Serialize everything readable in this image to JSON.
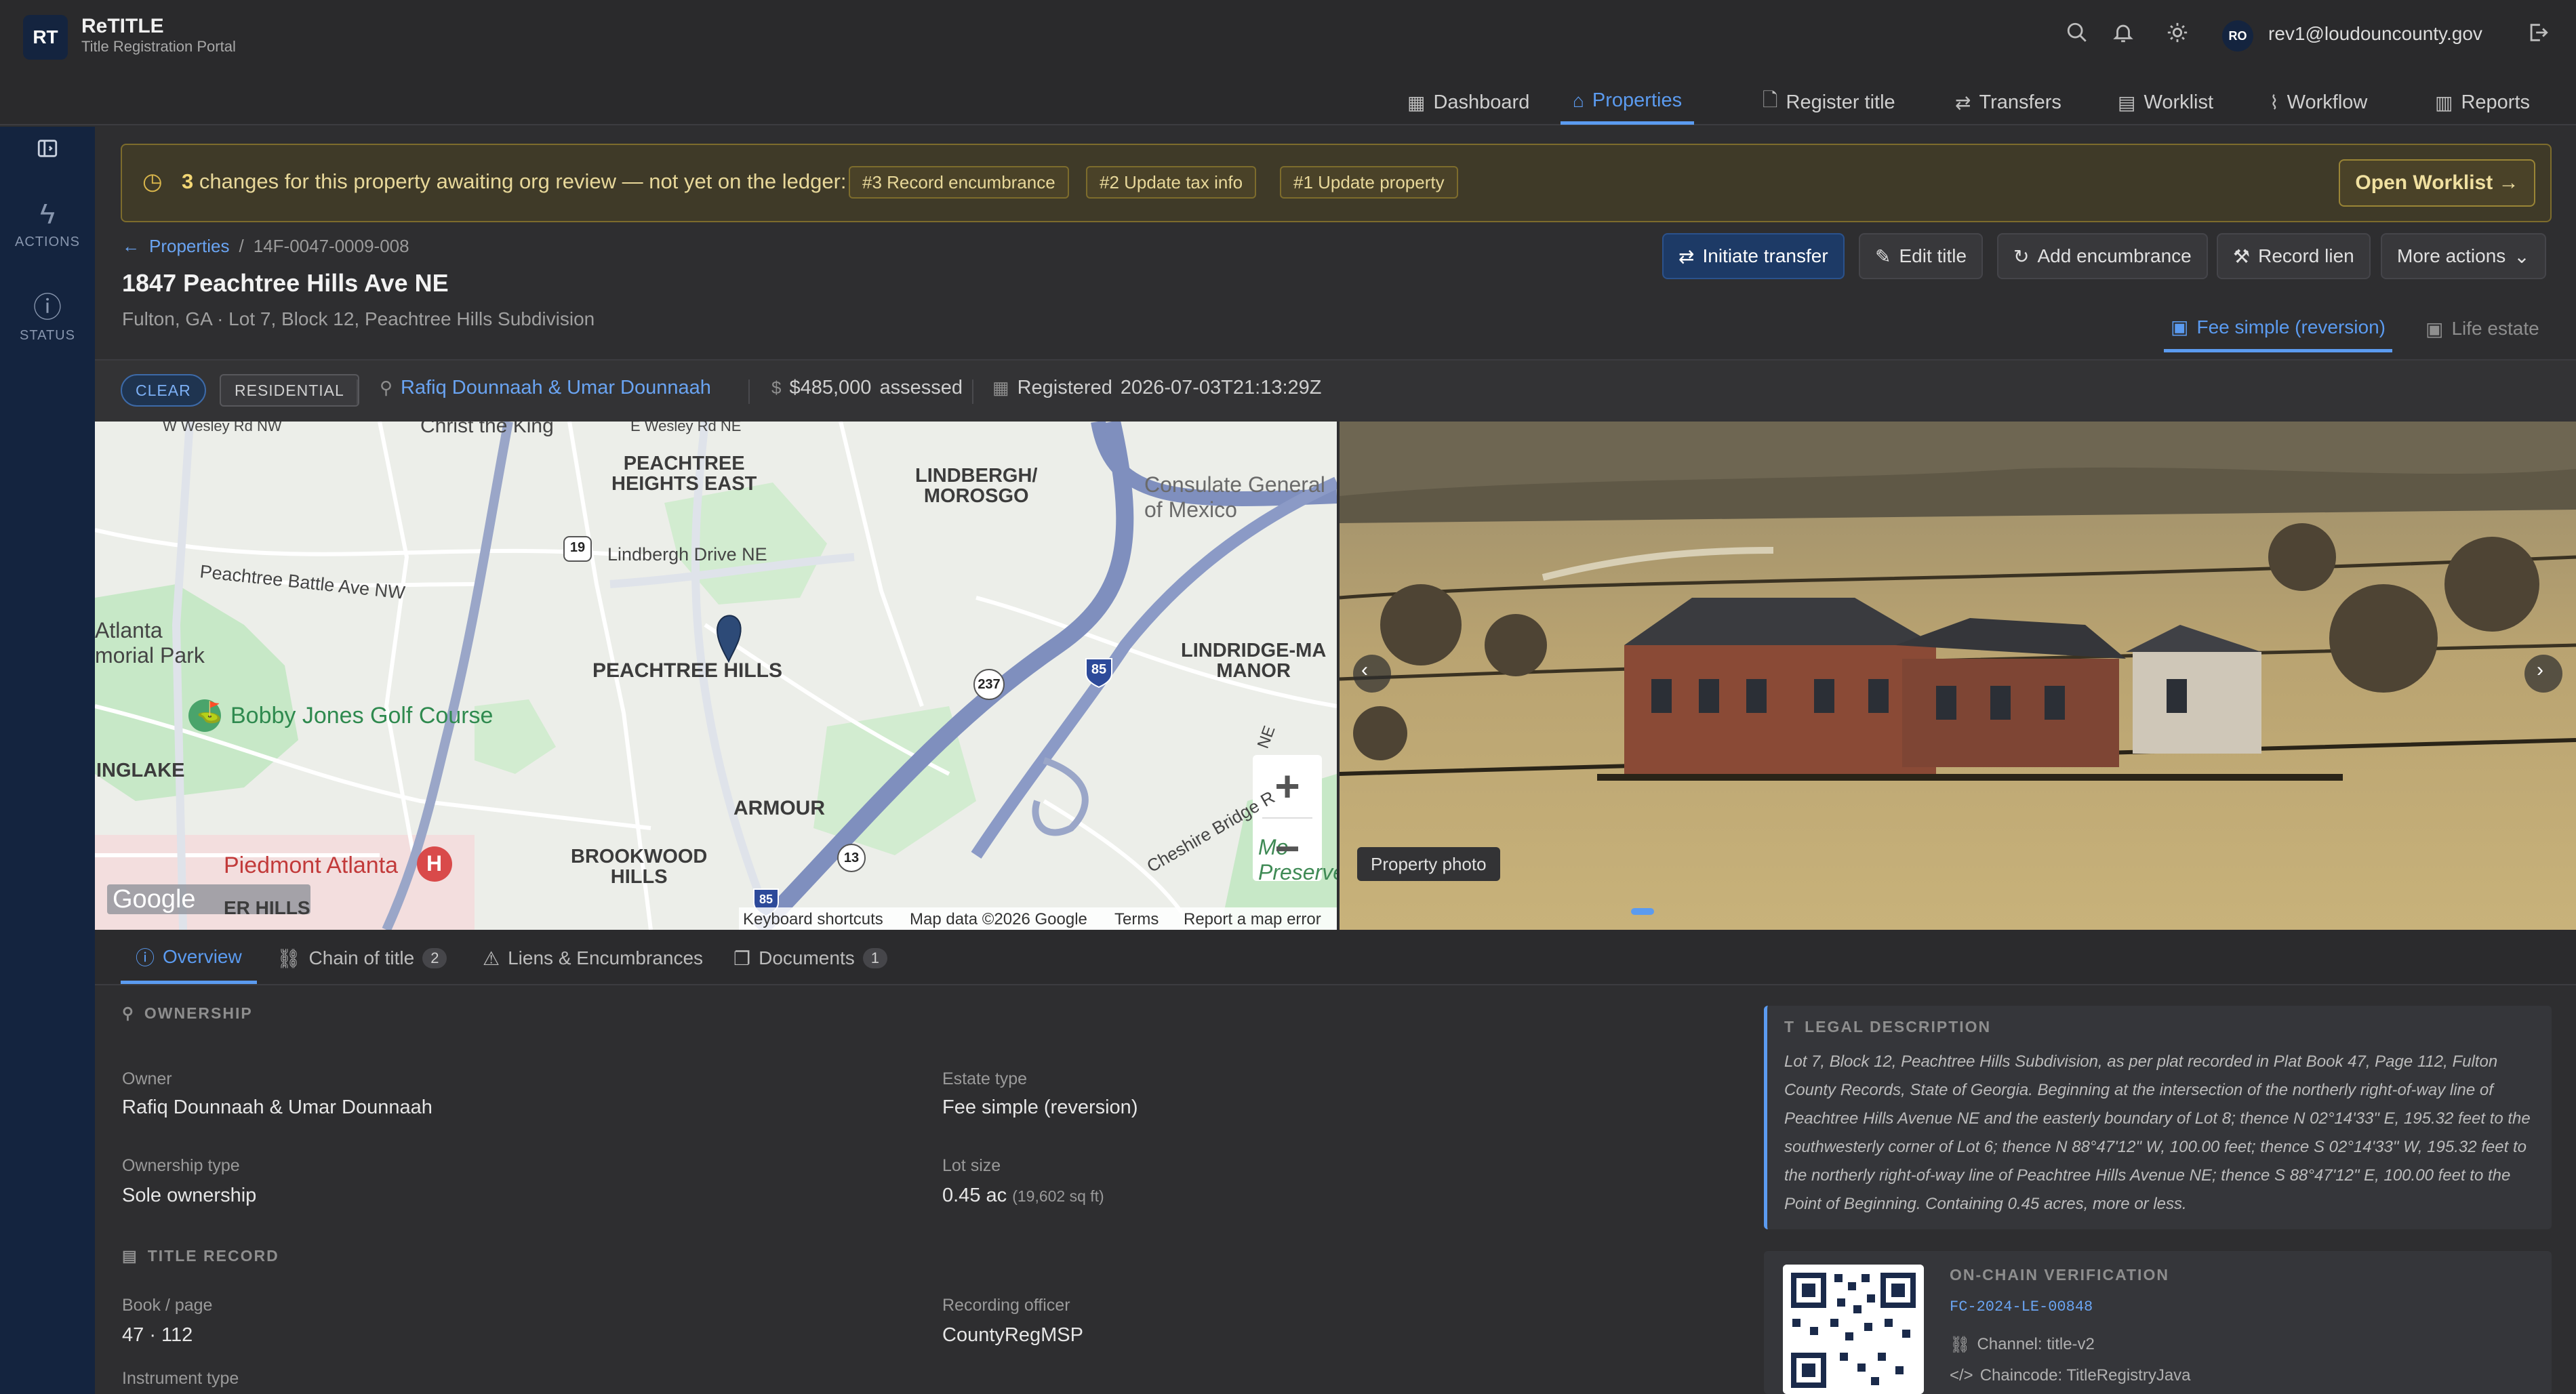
{
  "app": {
    "logo": "RT",
    "name": "ReTITLE",
    "subtitle": "Title Registration Portal"
  },
  "header": {
    "icons": [
      "search-icon",
      "bell-icon",
      "sun-icon",
      "logout-icon"
    ],
    "user": {
      "initials": "RO",
      "email": "rev1@loudouncounty.gov"
    }
  },
  "nav": {
    "items": [
      {
        "label": "Dashboard",
        "icon": "dashboard-icon"
      },
      {
        "label": "Properties",
        "icon": "home-icon",
        "active": true
      },
      {
        "label": "Register title",
        "icon": "file-plus-icon"
      },
      {
        "label": "Transfers",
        "icon": "transfer-icon"
      },
      {
        "label": "Worklist",
        "icon": "clipboard-icon"
      },
      {
        "label": "Workflow",
        "icon": "activity-icon"
      },
      {
        "label": "Reports",
        "icon": "building-icon"
      }
    ]
  },
  "sidebar": {
    "actions_label": "ACTIONS",
    "status_label": "STATUS"
  },
  "banner": {
    "count": "3",
    "message": "changes for this property awaiting org review — not yet on the ledger:",
    "chips": [
      "#3 Record encumbrance",
      "#2 Update tax info",
      "#1 Update property"
    ],
    "button": "Open Worklist →"
  },
  "breadcrumb": {
    "parent": "Properties",
    "current": "14F-0047-0009-008"
  },
  "property": {
    "title": "1847 Peachtree Hills Ave NE",
    "subtitle": "Fulton, GA · Lot 7, Block 12, Peachtree Hills Subdivision"
  },
  "actions": {
    "initiate": "Initiate transfer",
    "edit": "Edit title",
    "encumbrance": "Add encumbrance",
    "lien": "Record lien",
    "more": "More actions"
  },
  "estate_tabs": {
    "fee": "Fee simple (reversion)",
    "life": "Life estate"
  },
  "status": {
    "clear": "CLEAR",
    "type": "RESIDENTIAL",
    "owner": "Rafiq Dounnaah & Umar Dounnaah",
    "assessed_value": "$485,000",
    "assessed_label": "assessed",
    "registered_label": "Registered",
    "registered": "2026-07-03T21:13:29Z"
  },
  "map": {
    "labels": {
      "pe1": "PEACHTREE",
      "pe2": "HEIGHTS EAST",
      "lm1": "LINDBERGH/",
      "lm2": "MOROSGO",
      "consulate1": "Consulate General",
      "consulate2": "of Mexico",
      "ph": "PEACHTREE HILLS",
      "lind1": "LINDRIDGE-MA",
      "lind2": "MANOR",
      "armour": "ARMOUR",
      "bw1": "BROOKWOOD",
      "bw2": "HILLS",
      "inglake": "INGLAKE",
      "golf": "Bobby Jones Golf Course",
      "piedmont": "Piedmont Atlanta",
      "lindbergh": "Lindbergh Drive NE",
      "battle": "Peachtree Battle Ave NW",
      "atl1": "Atlanta",
      "atl2": "morial Park",
      "christ": "Christ the King",
      "wesley1": "W Wesley Rd NW",
      "wesley2": "E Wesley Rd NE",
      "cheshire": "Cheshire Bridge R",
      "ne": "NE",
      "preserve1": "Mo",
      "preserve2": "Preserve",
      "erhills": "ER HILLS",
      "shield_19": "19",
      "shield_237": "237",
      "shield_85": "85",
      "shield_13": "13",
      "shield_85b": "85"
    },
    "logo": "Google",
    "footer": [
      "Keyboard shortcuts",
      "Map data ©2026 Google",
      "Terms",
      "Report a map error"
    ]
  },
  "photo": {
    "caption": "Property photo"
  },
  "tabs": [
    {
      "label": "Overview",
      "icon": "info-icon"
    },
    {
      "label": "Chain of title",
      "icon": "chain-icon",
      "count": "2"
    },
    {
      "label": "Liens & Encumbrances",
      "icon": "alert-icon"
    },
    {
      "label": "Documents",
      "icon": "documents-icon",
      "count": "1"
    }
  ],
  "ownership": {
    "heading": "OWNERSHIP",
    "owner_label": "Owner",
    "owner": "Rafiq Dounnaah & Umar Dounnaah",
    "estate_label": "Estate type",
    "estate": "Fee simple (reversion)",
    "otype_label": "Ownership type",
    "otype": "Sole ownership",
    "lot_label": "Lot size",
    "lot": "0.45 ac",
    "lot_sqft": "(19,602 sq ft)"
  },
  "title_record": {
    "heading": "TITLE RECORD",
    "book_label": "Book / page",
    "book": "47 · 112",
    "officer_label": "Recording officer",
    "officer": "CountyRegMSP",
    "instrument_label": "Instrument type"
  },
  "legal": {
    "heading": "LEGAL DESCRIPTION",
    "text": "Lot 7, Block 12, Peachtree Hills Subdivision, as per plat recorded in Plat Book 47, Page 112, Fulton County Records, State of Georgia. Beginning at the intersection of the northerly right-of-way line of Peachtree Hills Avenue NE and the easterly boundary of Lot 8; thence N 02°14'33\" E, 195.32 feet to the southwesterly corner of Lot 6; thence N 88°47'12\" W, 100.00 feet; thence S 02°14'33\" W, 195.32 feet to the northerly right-of-way line of Peachtree Hills Avenue NE; thence S 88°47'12\" E, 100.00 feet to the Point of Beginning. Containing 0.45 acres, more or less."
  },
  "chain": {
    "heading": "ON-CHAIN VERIFICATION",
    "id": "FC-2024-LE-00848",
    "channel": "Channel: title-v2",
    "chaincode": "Chaincode: TitleRegistryJava"
  }
}
